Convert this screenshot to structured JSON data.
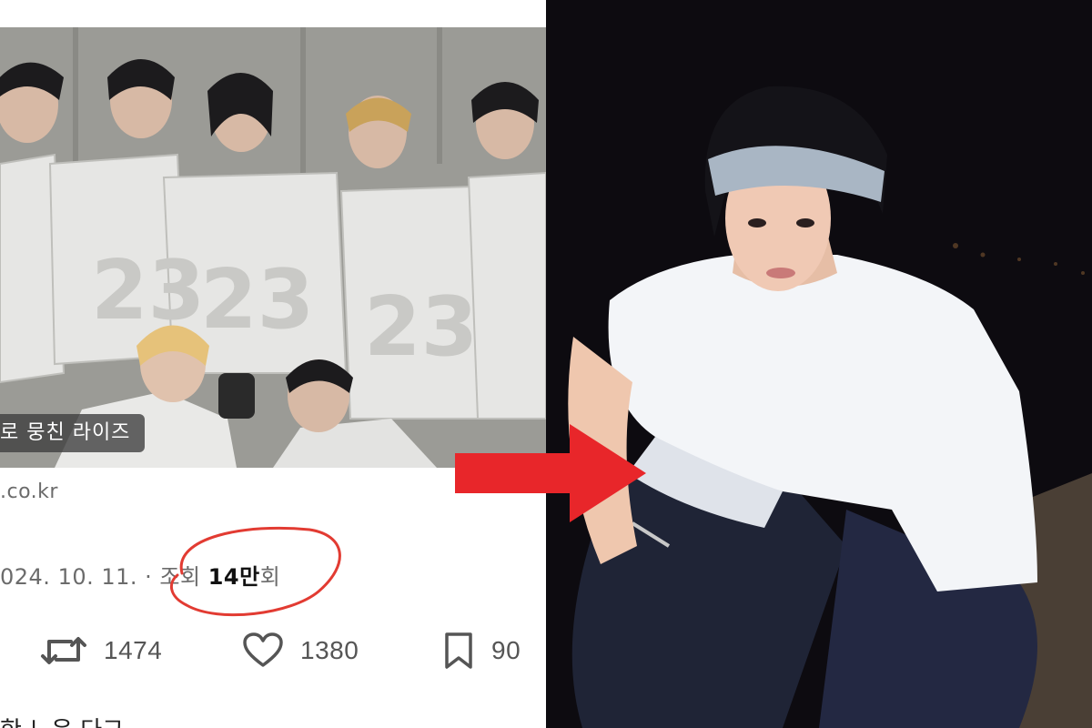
{
  "tweet": {
    "image_caption": "로 뭉친 라이즈",
    "link_domain": ".co.kr",
    "date": "024. 10. 11.",
    "separator": " · ",
    "views_label": "조회 ",
    "views_count": "14만",
    "views_suffix": "회",
    "actions": {
      "retweets": "1474",
      "likes": "1380",
      "bookmarks": "90"
    },
    "next_line_cut": "한 느은 다그"
  },
  "colors": {
    "arrow": "#e8262a",
    "circle": "#e23b32",
    "muted_text": "#6b6b6b"
  },
  "icons": [
    "retweet-icon",
    "heart-icon",
    "bookmark-icon",
    "arrow-right-icon"
  ]
}
